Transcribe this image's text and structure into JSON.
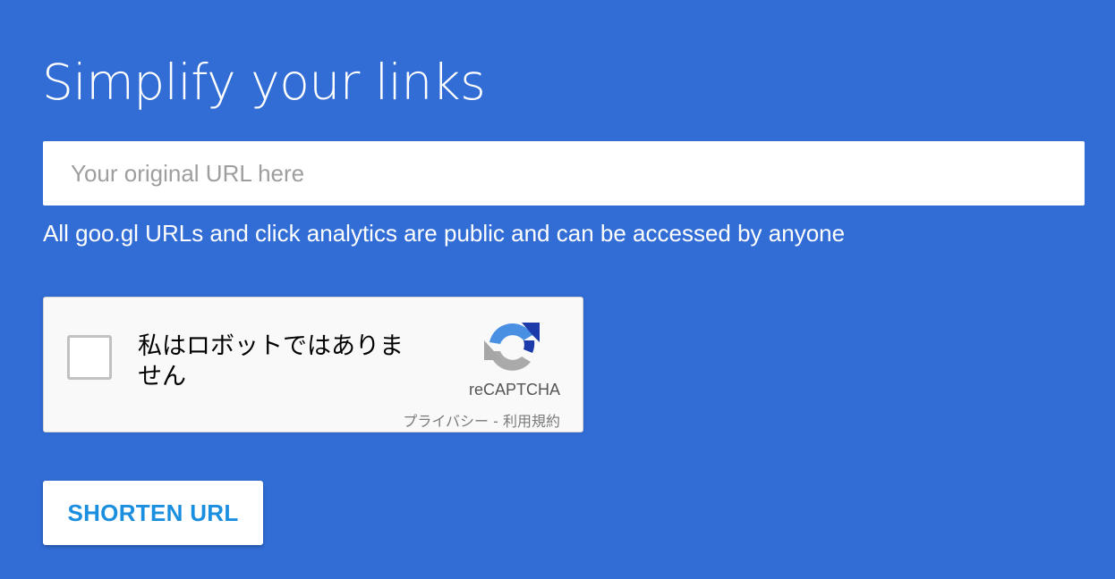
{
  "page": {
    "title": "Simplify your links",
    "background_color": "#326dd6"
  },
  "url_input": {
    "placeholder": "Your original URL here",
    "value": ""
  },
  "notice": {
    "text": "All goo.gl URLs and click analytics are public and can be accessed by anyone"
  },
  "captcha": {
    "label": "私はロボットではありません",
    "brand": "reCAPTCHA",
    "privacy_link": "プライバシー",
    "separator": " - ",
    "terms_link": "利用規約",
    "checked": false,
    "logo_icon": "recaptcha-logo-icon"
  },
  "actions": {
    "shorten_label": "SHORTEN URL",
    "accent_color": "#1a8fe0"
  }
}
